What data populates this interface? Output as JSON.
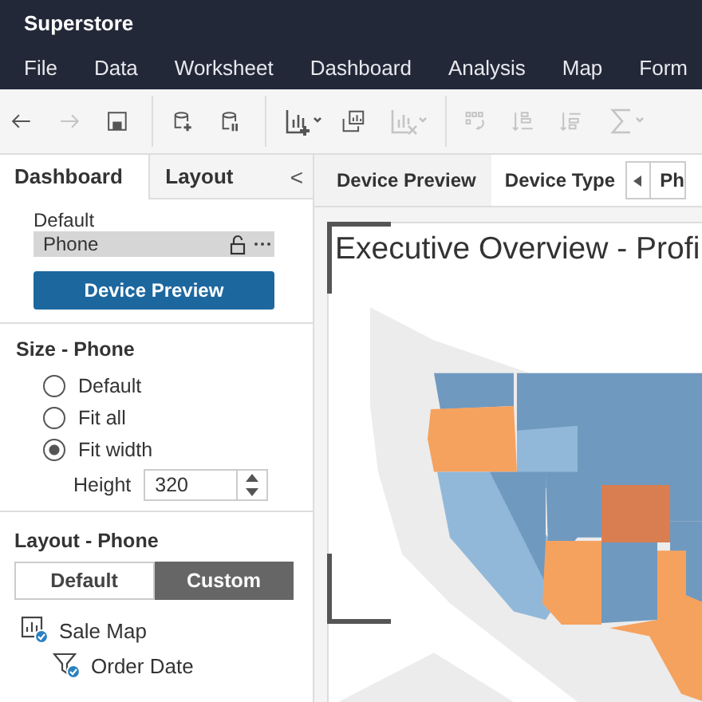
{
  "window": {
    "title": "Superstore"
  },
  "menu": [
    "File",
    "Data",
    "Worksheet",
    "Dashboard",
    "Analysis",
    "Map",
    "Form"
  ],
  "toolbar": [
    {
      "kind": "back",
      "disabled": false
    },
    {
      "kind": "forward",
      "disabled": true
    },
    {
      "kind": "save",
      "disabled": false
    },
    {
      "kind": "sep"
    },
    {
      "kind": "new-source",
      "disabled": false
    },
    {
      "kind": "pause",
      "disabled": false
    },
    {
      "kind": "sep"
    },
    {
      "kind": "new-sheet",
      "disabled": false
    },
    {
      "kind": "duplicate",
      "disabled": false
    },
    {
      "kind": "clear",
      "disabled": true
    },
    {
      "kind": "sep"
    },
    {
      "kind": "swap",
      "disabled": true
    },
    {
      "kind": "sort-asc",
      "disabled": true
    },
    {
      "kind": "sort-desc",
      "disabled": true
    },
    {
      "kind": "sum",
      "disabled": true
    }
  ],
  "panel_tabs": [
    {
      "label": "Dashboard",
      "selected": true
    },
    {
      "label": "Layout",
      "selected": false
    }
  ],
  "collapse": "<",
  "device": {
    "label": "Default",
    "value": "Phone",
    "button": "Device Preview"
  },
  "size": {
    "heading": "Size - Phone",
    "options": [
      {
        "label": "Default",
        "selected": false
      },
      {
        "label": "Fit all",
        "selected": false
      },
      {
        "label": "Fit width",
        "selected": true
      }
    ],
    "height_label": "Height",
    "height_value": "320"
  },
  "layout": {
    "heading": "Layout - Phone",
    "modes": [
      {
        "label": "Default",
        "selected": false
      },
      {
        "label": "Custom",
        "selected": true
      }
    ],
    "items": [
      {
        "kind": "sheet",
        "label": "Sale Map",
        "children": [
          {
            "kind": "filter",
            "label": "Order Date"
          }
        ]
      }
    ]
  },
  "preview": {
    "tab": "Device Preview",
    "device_type_label": "Device Type",
    "device_type_value": "Ph",
    "title": "Executive Overview - Profi"
  }
}
